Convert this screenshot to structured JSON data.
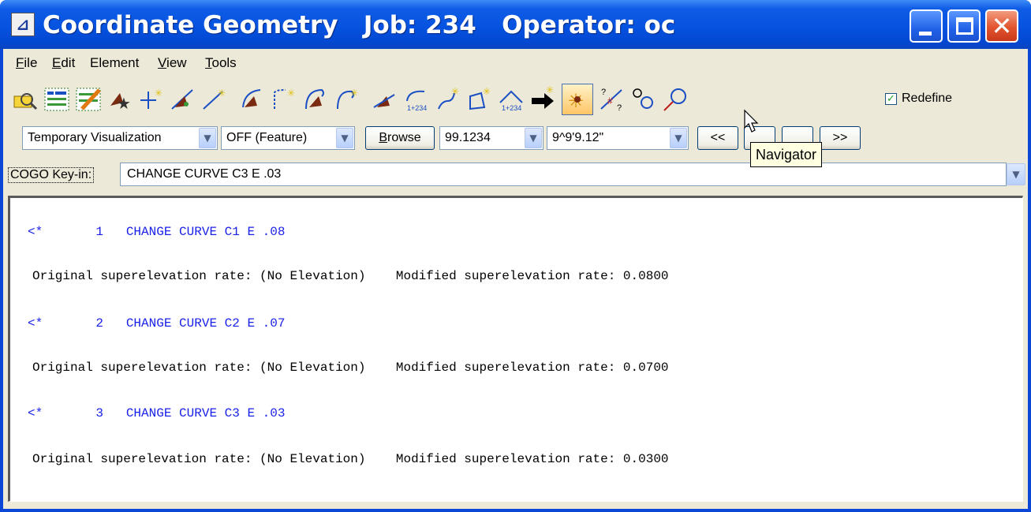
{
  "window": {
    "title": "Coordinate Geometry   Job: 234   Operator: oc",
    "app_icon": "ruler-icon"
  },
  "menu": {
    "items": [
      {
        "label": "File",
        "mnemonic": "F"
      },
      {
        "label": "Edit",
        "mnemonic": "E"
      },
      {
        "label": "Element",
        "mnemonic": ""
      },
      {
        "label": "View",
        "mnemonic": "V"
      },
      {
        "label": "Tools",
        "mnemonic": "T"
      }
    ]
  },
  "toolbar": {
    "redefine_label": "Redefine",
    "redefine_checked": true,
    "active_tool": "navigator"
  },
  "row2": {
    "visualization": "Temporary Visualization",
    "feature_mode": "OFF (Feature)",
    "browse_label": "Browse",
    "distance_value": "99.1234",
    "angle_value": "9^9'9.12\"",
    "prev_label": "<<",
    "next_label": ">>"
  },
  "keyin": {
    "label": "COGO Key-in:",
    "value": "CHANGE CURVE C3 E .03"
  },
  "output": {
    "lines": [
      {
        "type": "cmd",
        "text": "<*       1   CHANGE CURVE C1 E .08"
      },
      {
        "type": "result",
        "text": "Original superelevation rate: (No Elevation)    Modified superelevation rate: 0.0800"
      },
      {
        "type": "cmd",
        "text": "<*       2   CHANGE CURVE C2 E .07"
      },
      {
        "type": "result",
        "text": "Original superelevation rate: (No Elevation)    Modified superelevation rate: 0.0700"
      },
      {
        "type": "cmd",
        "text": "<*       3   CHANGE CURVE C3 E .03"
      },
      {
        "type": "result",
        "text": "Original superelevation rate: (No Elevation)    Modified superelevation rate: 0.0300"
      }
    ]
  },
  "tooltip": {
    "text": "Navigator"
  },
  "colors": {
    "titlebar": "#0553e0",
    "command_text": "#1b22e8",
    "client_bg": "#ece9d8",
    "active_tool_bg": "#ffc566"
  }
}
